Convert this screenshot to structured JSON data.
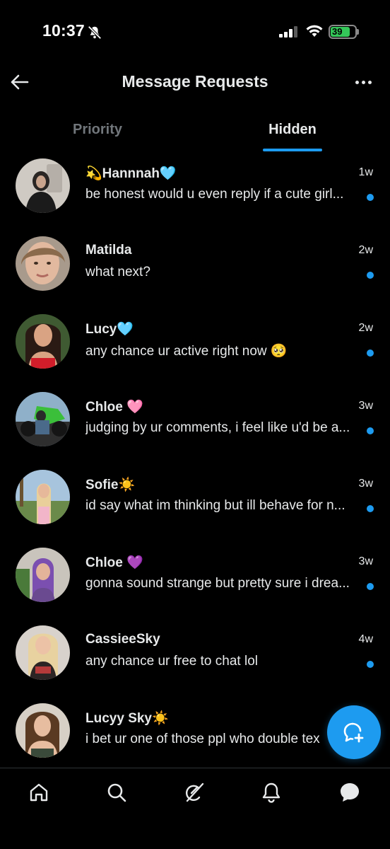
{
  "status_bar": {
    "time": "10:37",
    "battery_level": "39",
    "battery_charging": true
  },
  "header": {
    "title": "Message Requests",
    "back_icon": "arrow-left-icon",
    "more_icon": "more-horizontal-icon"
  },
  "tabs": [
    {
      "label": "Priority",
      "active": false
    },
    {
      "label": "Hidden",
      "active": true
    }
  ],
  "conversations": [
    {
      "name": "💫Hannnah🩵",
      "preview": "be honest would u even reply if a cute girl...",
      "age": "1w",
      "unread": true
    },
    {
      "name": "Matilda",
      "preview": "what next?",
      "age": "2w",
      "unread": true
    },
    {
      "name": "Lucy🩵",
      "preview": "any chance ur active right now 🥺",
      "age": "2w",
      "unread": true
    },
    {
      "name": "Chloe 🩷",
      "preview": "judging by ur comments, i feel like u'd be a...",
      "age": "3w",
      "unread": true
    },
    {
      "name": "Sofie☀️",
      "preview": "id say what im thinking but ill behave for n...",
      "age": "3w",
      "unread": true
    },
    {
      "name": "Chloe 💜",
      "preview": "gonna sound strange but pretty sure i drea...",
      "age": "3w",
      "unread": true
    },
    {
      "name": "CassieeSky",
      "preview": "any chance ur free to chat lol",
      "age": "4w",
      "unread": true
    },
    {
      "name": "Lucyy Sky☀️",
      "preview": "i bet ur one of those ppl who double tex",
      "age": "",
      "unread": false
    }
  ],
  "fab": {
    "icon": "new-message-icon"
  },
  "bottom_nav": [
    {
      "icon": "home-icon"
    },
    {
      "icon": "search-icon"
    },
    {
      "icon": "grok-icon"
    },
    {
      "icon": "notifications-icon"
    },
    {
      "icon": "messages-icon",
      "active": true
    }
  ],
  "colors": {
    "accent": "#1d9bf0",
    "background": "#000000",
    "text_primary": "#e7e9ea",
    "text_secondary": "#71767b",
    "battery": "#34c759"
  }
}
